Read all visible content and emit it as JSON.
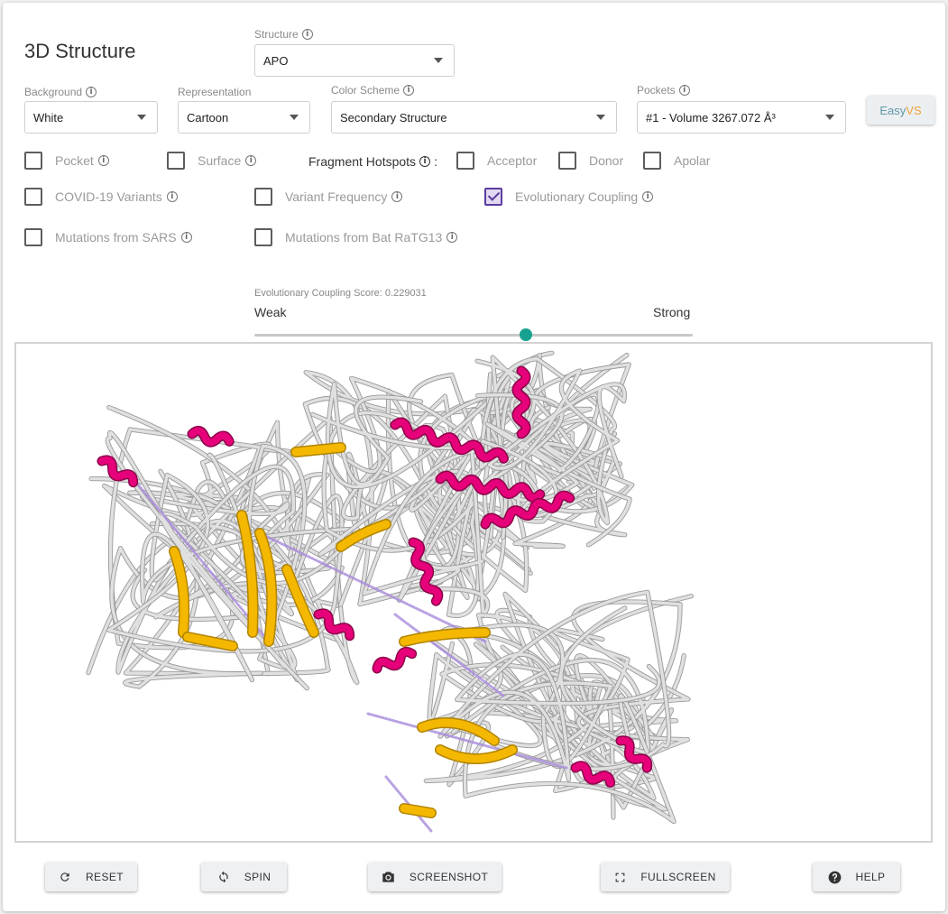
{
  "header": {
    "title": "3D Structure"
  },
  "structure": {
    "label": "Structure",
    "value": "APO"
  },
  "background": {
    "label": "Background",
    "value": "White"
  },
  "representation": {
    "label": "Representation",
    "value": "Cartoon"
  },
  "color_scheme": {
    "label": "Color Scheme",
    "value": "Secondary Structure"
  },
  "pockets": {
    "label": "Pockets",
    "value": "#1 - Volume 3267.072 Å³"
  },
  "easyvs": {
    "part1": "Easy",
    "part2": "VS",
    "color1": "#5f96a6",
    "color2": "#f2a23b"
  },
  "checkboxes": {
    "pocket": {
      "label": "Pocket",
      "checked": false
    },
    "surface": {
      "label": "Surface",
      "checked": false
    },
    "hotspots_label": "Fragment Hotspots",
    "hotspots_colon": ":",
    "acceptor": {
      "label": "Acceptor",
      "checked": false
    },
    "donor": {
      "label": "Donor",
      "checked": false
    },
    "apolar": {
      "label": "Apolar",
      "checked": false
    },
    "covid_variants": {
      "label": "COVID-19 Variants",
      "checked": false
    },
    "variant_frequency": {
      "label": "Variant Frequency",
      "checked": false
    },
    "evolutionary_coupling": {
      "label": "Evolutionary Coupling",
      "checked": true
    },
    "mutations_sars": {
      "label": "Mutations from SARS",
      "checked": false
    },
    "mutations_ratg13": {
      "label": "Mutations from Bat RaTG13",
      "checked": false
    }
  },
  "slider": {
    "caption": "Evolutionary Coupling Score: 0.229031",
    "min_label": "Weak",
    "max_label": "Strong",
    "position_fraction": 0.62,
    "color": "#16a190"
  },
  "viewer": {
    "helix_color": "#e6007a",
    "strand_color": "#f5b800",
    "coil_color": "#e0e0e0",
    "coupling_color": "#a78bdb"
  },
  "buttons": {
    "reset": "RESET",
    "spin": "SPIN",
    "screenshot": "SCREENSHOT",
    "fullscreen": "FULLSCREEN",
    "help": "HELP"
  },
  "icons": {
    "reset": "refresh-icon",
    "spin": "sync-icon",
    "screenshot": "camera-icon",
    "fullscreen": "fullscreen-icon",
    "help": "help-circle-icon",
    "info": "info-icon"
  }
}
